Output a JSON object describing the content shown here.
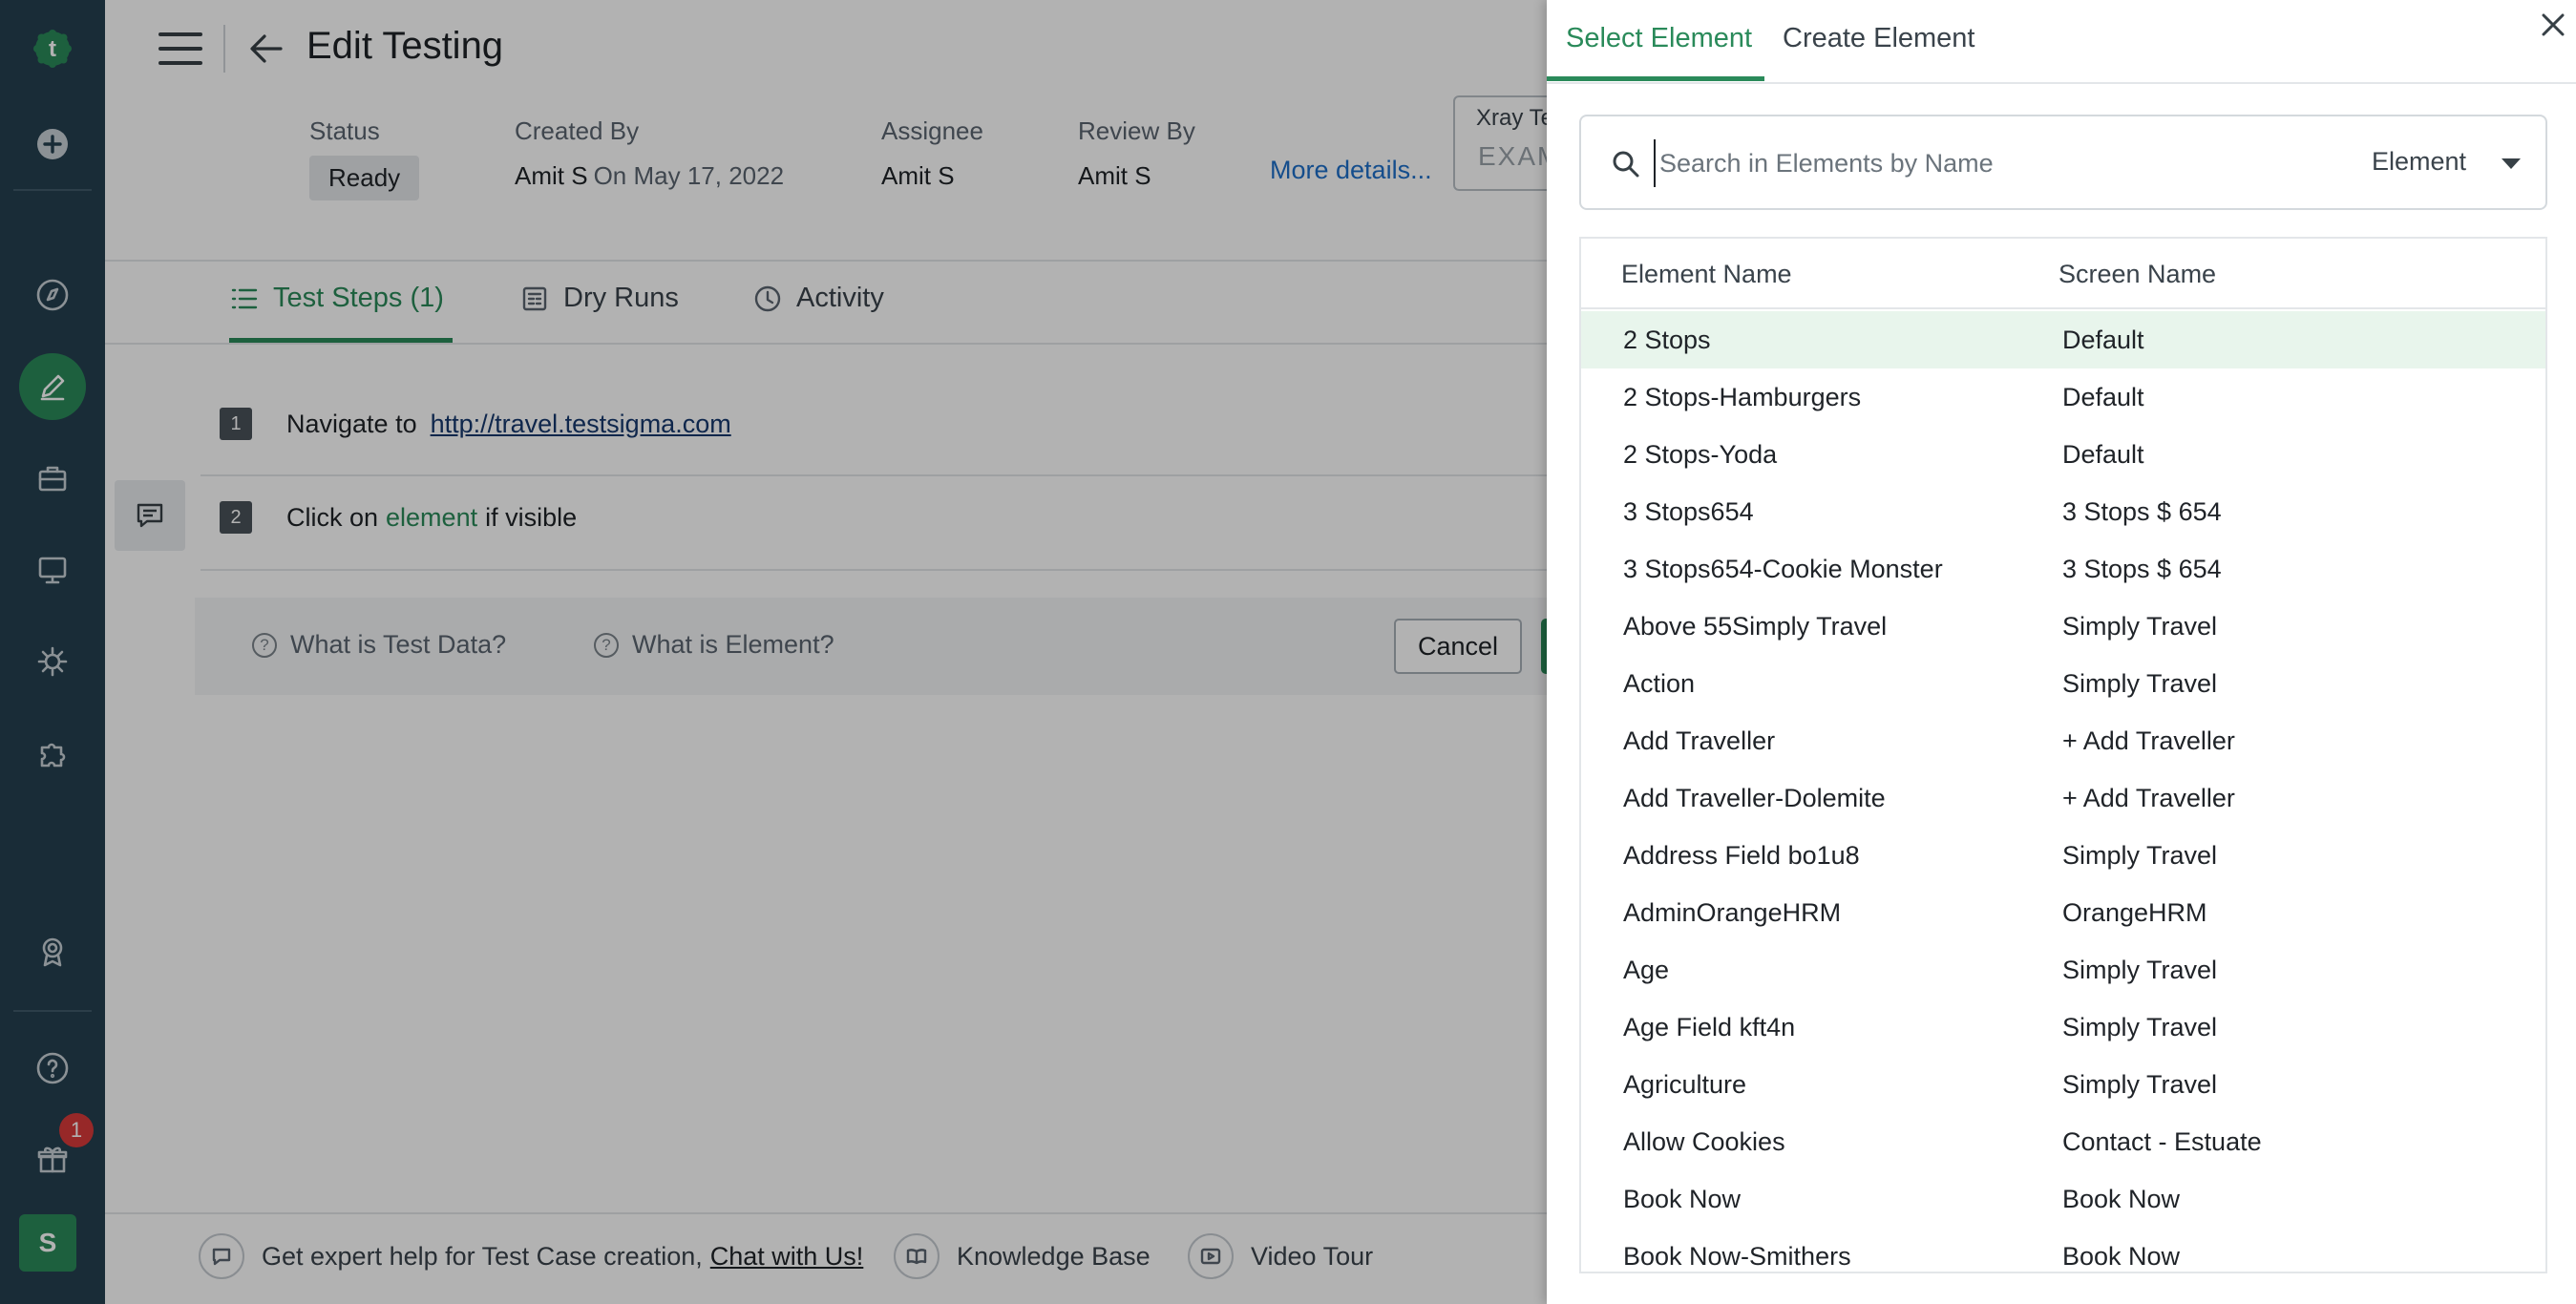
{
  "header": {
    "title": "Edit Testing"
  },
  "meta": {
    "status_label": "Status",
    "status_value": "Ready",
    "created_by_label": "Created By",
    "created_by_value": "Amit S",
    "created_on": "On May 17, 2022",
    "assignee_label": "Assignee",
    "assignee_value": "Amit S",
    "review_by_label": "Review By",
    "review_by_value": "Amit S",
    "more_details": "More details...",
    "xray_label": "Xray Te",
    "xray_placeholder": "EXAM"
  },
  "tabs": [
    {
      "label": "Test Steps (1)",
      "icon": "list-icon",
      "active": true
    },
    {
      "label": "Dry Runs",
      "icon": "dry-runs-icon",
      "active": false
    },
    {
      "label": "Activity",
      "icon": "clock-icon",
      "active": false
    }
  ],
  "steps": [
    {
      "num": "1",
      "text": "Navigate to",
      "link": "http://travel.testsigma.com"
    },
    {
      "num": "2",
      "text_before": "Click on",
      "element": "element",
      "text_after": "if visible"
    }
  ],
  "help": {
    "test_data": "What is Test Data?",
    "element": "What is Element?",
    "cancel": "Cancel"
  },
  "footer": {
    "expert_text": "Get expert help for Test Case creation,",
    "chat_link": "Chat with Us!",
    "knowledge_base": "Knowledge Base",
    "video_tour": "Video Tour"
  },
  "rail": {
    "notification_count": "1",
    "user_initial": "S"
  },
  "panel": {
    "tabs": [
      {
        "label": "Select Element",
        "active": true
      },
      {
        "label": "Create Element",
        "active": false
      }
    ],
    "search_placeholder": "Search in Elements by Name",
    "filter_value": "Element",
    "columns": [
      "Element Name",
      "Screen Name"
    ],
    "rows": [
      {
        "element": "2 Stops",
        "screen": "Default",
        "selected": true
      },
      {
        "element": "2 Stops-Hamburgers",
        "screen": "Default"
      },
      {
        "element": "2 Stops-Yoda",
        "screen": "Default"
      },
      {
        "element": "3 Stops654",
        "screen": "3 Stops $ 654"
      },
      {
        "element": "3 Stops654-Cookie Monster",
        "screen": "3 Stops $ 654"
      },
      {
        "element": "Above 55Simply Travel",
        "screen": "Simply Travel"
      },
      {
        "element": "Action",
        "screen": "Simply Travel"
      },
      {
        "element": "Add Traveller",
        "screen": "+ Add Traveller"
      },
      {
        "element": "Add Traveller-Dolemite",
        "screen": "+ Add Traveller"
      },
      {
        "element": "Address Field bo1u8",
        "screen": "Simply Travel"
      },
      {
        "element": "AdminOrangeHRM",
        "screen": "OrangeHRM"
      },
      {
        "element": "Age",
        "screen": "Simply Travel"
      },
      {
        "element": "Age Field kft4n",
        "screen": "Simply Travel"
      },
      {
        "element": "Agriculture",
        "screen": "Simply Travel"
      },
      {
        "element": "Allow Cookies",
        "screen": "Contact - Estuate"
      },
      {
        "element": "Book Now",
        "screen": "Book Now"
      },
      {
        "element": "Book Now-Smithers",
        "screen": "Book Now"
      }
    ]
  },
  "colors": {
    "brand_green": "#2a8a5a",
    "rail_bg": "#25404f",
    "link_blue": "#1e6fc9",
    "selected_row": "#e8f5ec"
  }
}
